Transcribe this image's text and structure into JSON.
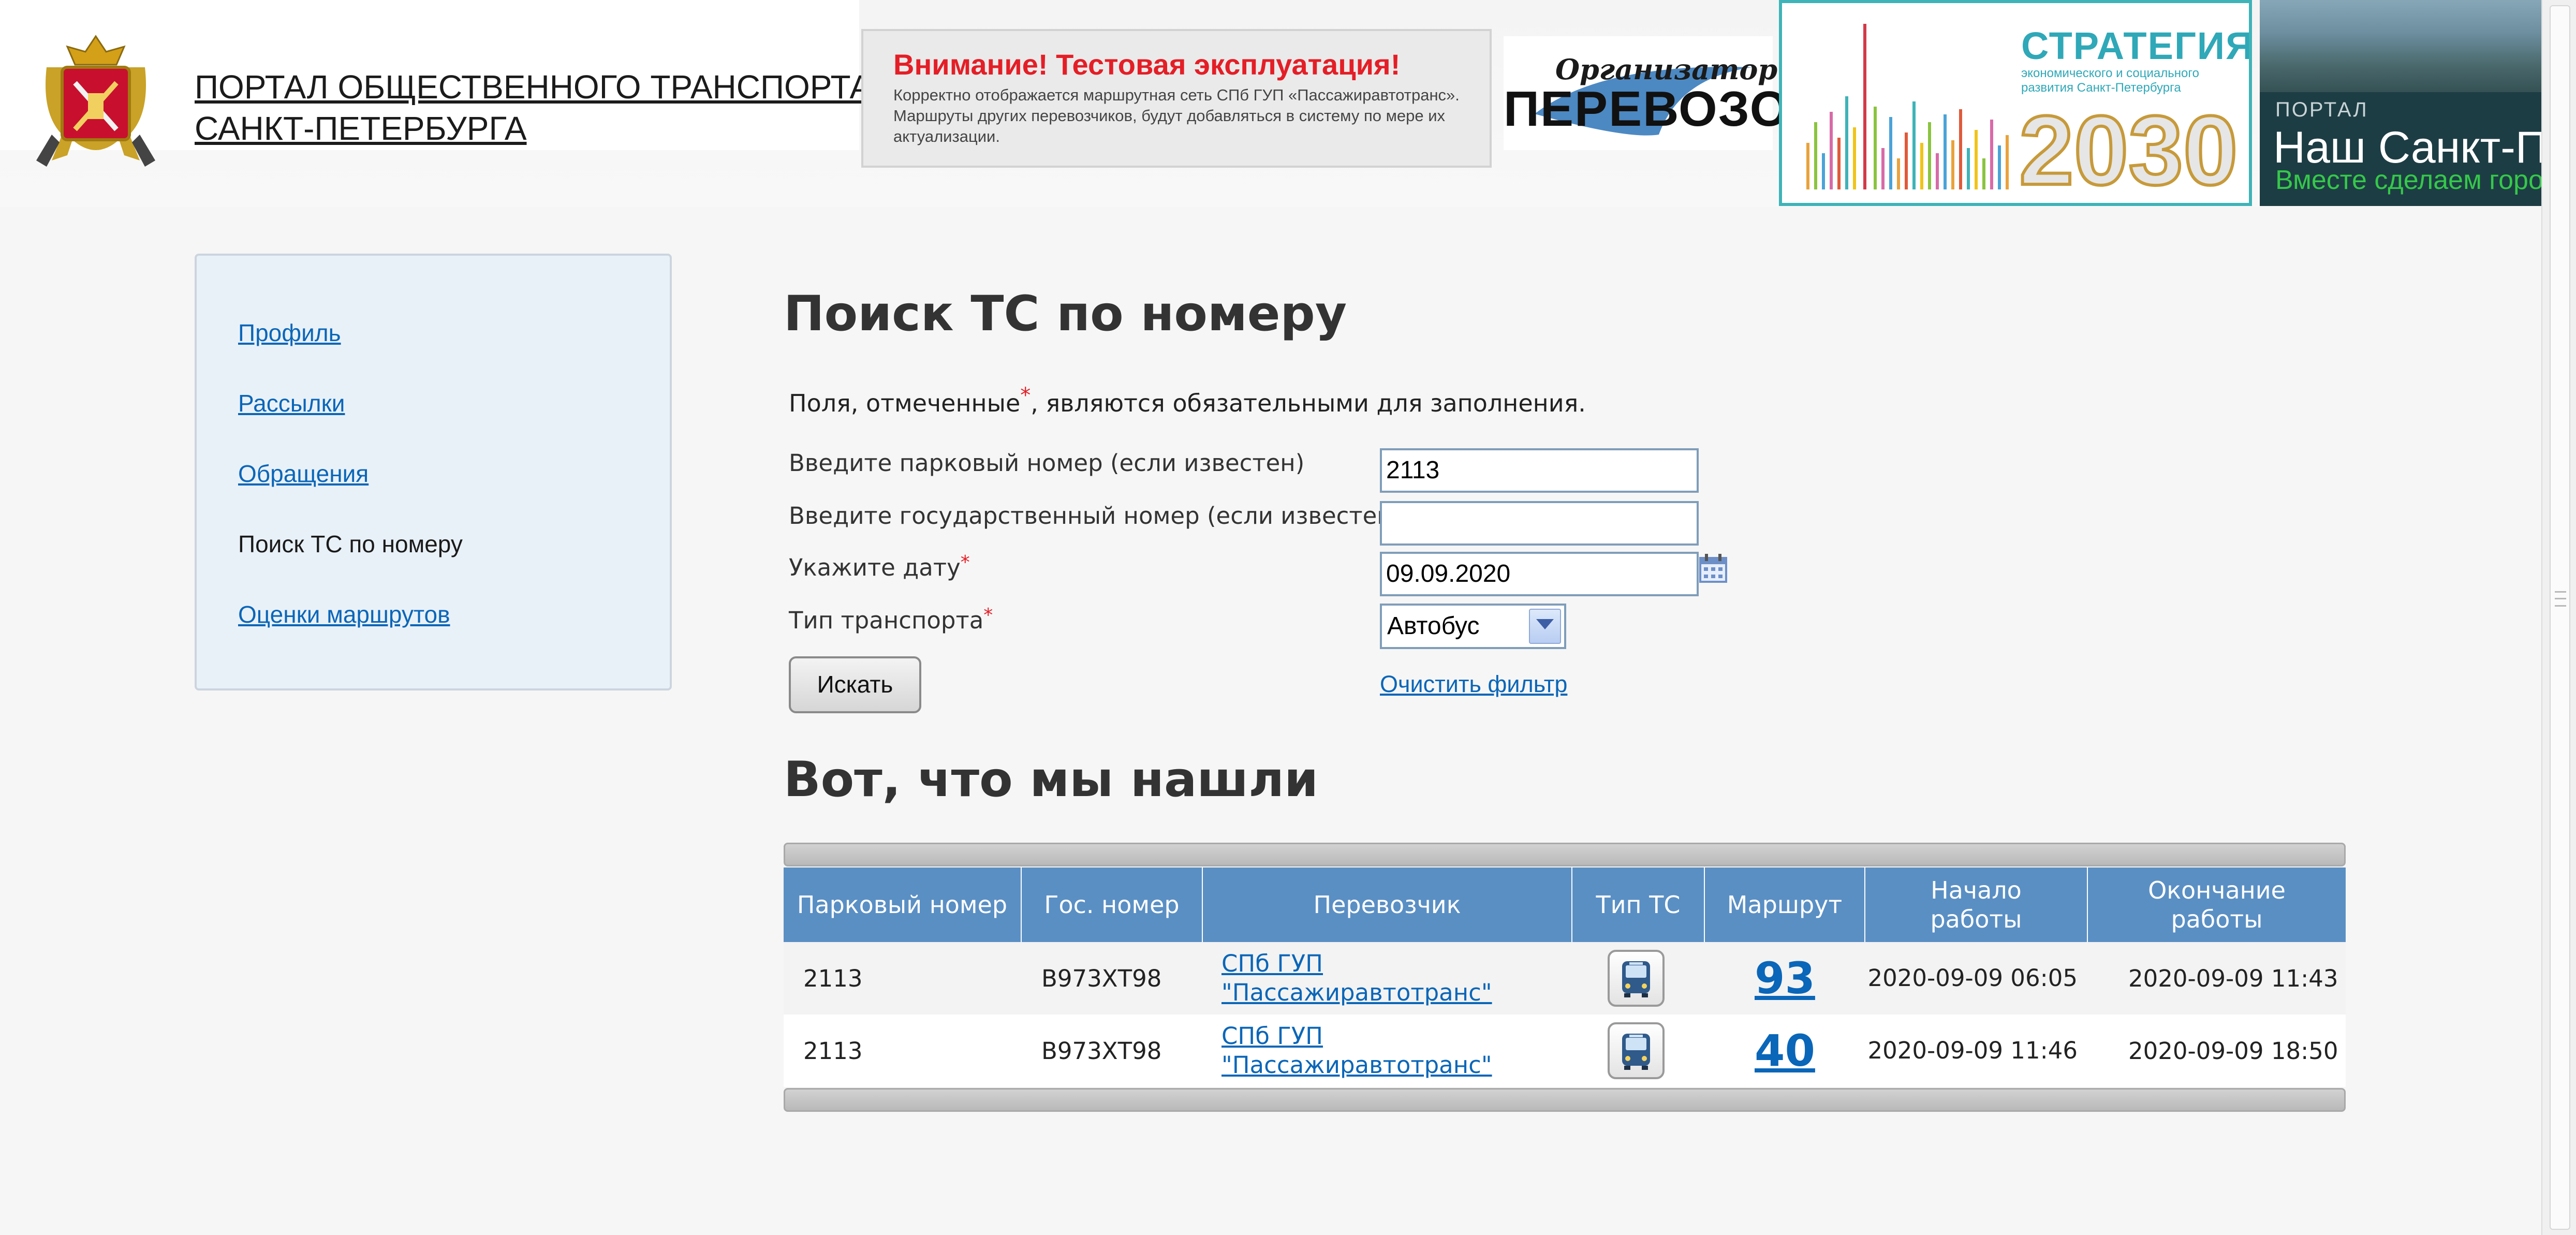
{
  "header": {
    "portal_title_line1": "ПОРТАЛ ОБЩЕСТВЕННОГО ТРАНСПОРТА",
    "portal_title_line2": "САНКТ-ПЕТЕРБУРГА",
    "notice_title": "Внимание! Тестовая эксплуатация!",
    "notice_text": "Корректно отображается маршрутная сеть СПб ГУП «Пассажиравтотранс». Маршруты других перевозчиков, будут добавляться в систему по мере их актуализации.",
    "banners": {
      "organizer_top": "Организатор",
      "organizer_bottom": "ПЕРЕВОЗОК",
      "strategy_title": "СТРАТЕГИЯ",
      "strategy_sub": "экономического и социального развития Санкт-Петербурга",
      "strategy_year": "2030",
      "nash_portal": "ПОРТАЛ",
      "nash_name": "Наш Санкт-Пет",
      "nash_slogan": "Вместе сделаем город"
    }
  },
  "sidebar": {
    "items": [
      {
        "label": "Профиль",
        "active": false
      },
      {
        "label": "Рассылки",
        "active": false
      },
      {
        "label": "Обращения",
        "active": false
      },
      {
        "label": "Поиск ТС по номеру",
        "active": true
      },
      {
        "label": "Оценки маршрутов",
        "active": false
      }
    ]
  },
  "search_form": {
    "title": "Поиск ТС по номеру",
    "required_note_prefix": "Поля, отмеченные",
    "required_note_suffix": ", являются обязательными для заполнения.",
    "required_star": "*",
    "park_number_label": "Введите парковый номер (если известен)",
    "park_number_value": "2113",
    "state_number_label": "Введите государственный номер (если известен)",
    "state_number_value": "",
    "date_label": "Укажите дату",
    "date_value": "09.09.2020",
    "transport_type_label": "Тип транспорта",
    "transport_type_value": "Автобус",
    "search_button": "Искать",
    "clear_filter": "Очистить фильтр"
  },
  "results": {
    "title": "Вот, что мы нашли",
    "columns": [
      "Парковый номер",
      "Гос. номер",
      "Перевозчик",
      "Тип ТС",
      "Маршрут",
      "Начало работы",
      "Окончание работы"
    ],
    "rows": [
      {
        "park_number": "2113",
        "state_number": "В973ХТ98",
        "carrier_line1": "СПб ГУП",
        "carrier_line2": "\"Пассажиравтотранс\"",
        "type_icon": "bus-icon",
        "route": "93",
        "start": "2020-09-09 06:05",
        "end": "2020-09-09 11:43"
      },
      {
        "park_number": "2113",
        "state_number": "В973ХТ98",
        "carrier_line1": "СПб ГУП",
        "carrier_line2": "\"Пассажиравтотранс\"",
        "type_icon": "bus-icon",
        "route": "40",
        "start": "2020-09-09 11:46",
        "end": "2020-09-09 18:50"
      }
    ]
  },
  "colors": {
    "link": "#0a66b8",
    "table_header": "#5a8fc4",
    "required_star": "#e41e26",
    "sidebar_bg": "#e9f1f8"
  }
}
